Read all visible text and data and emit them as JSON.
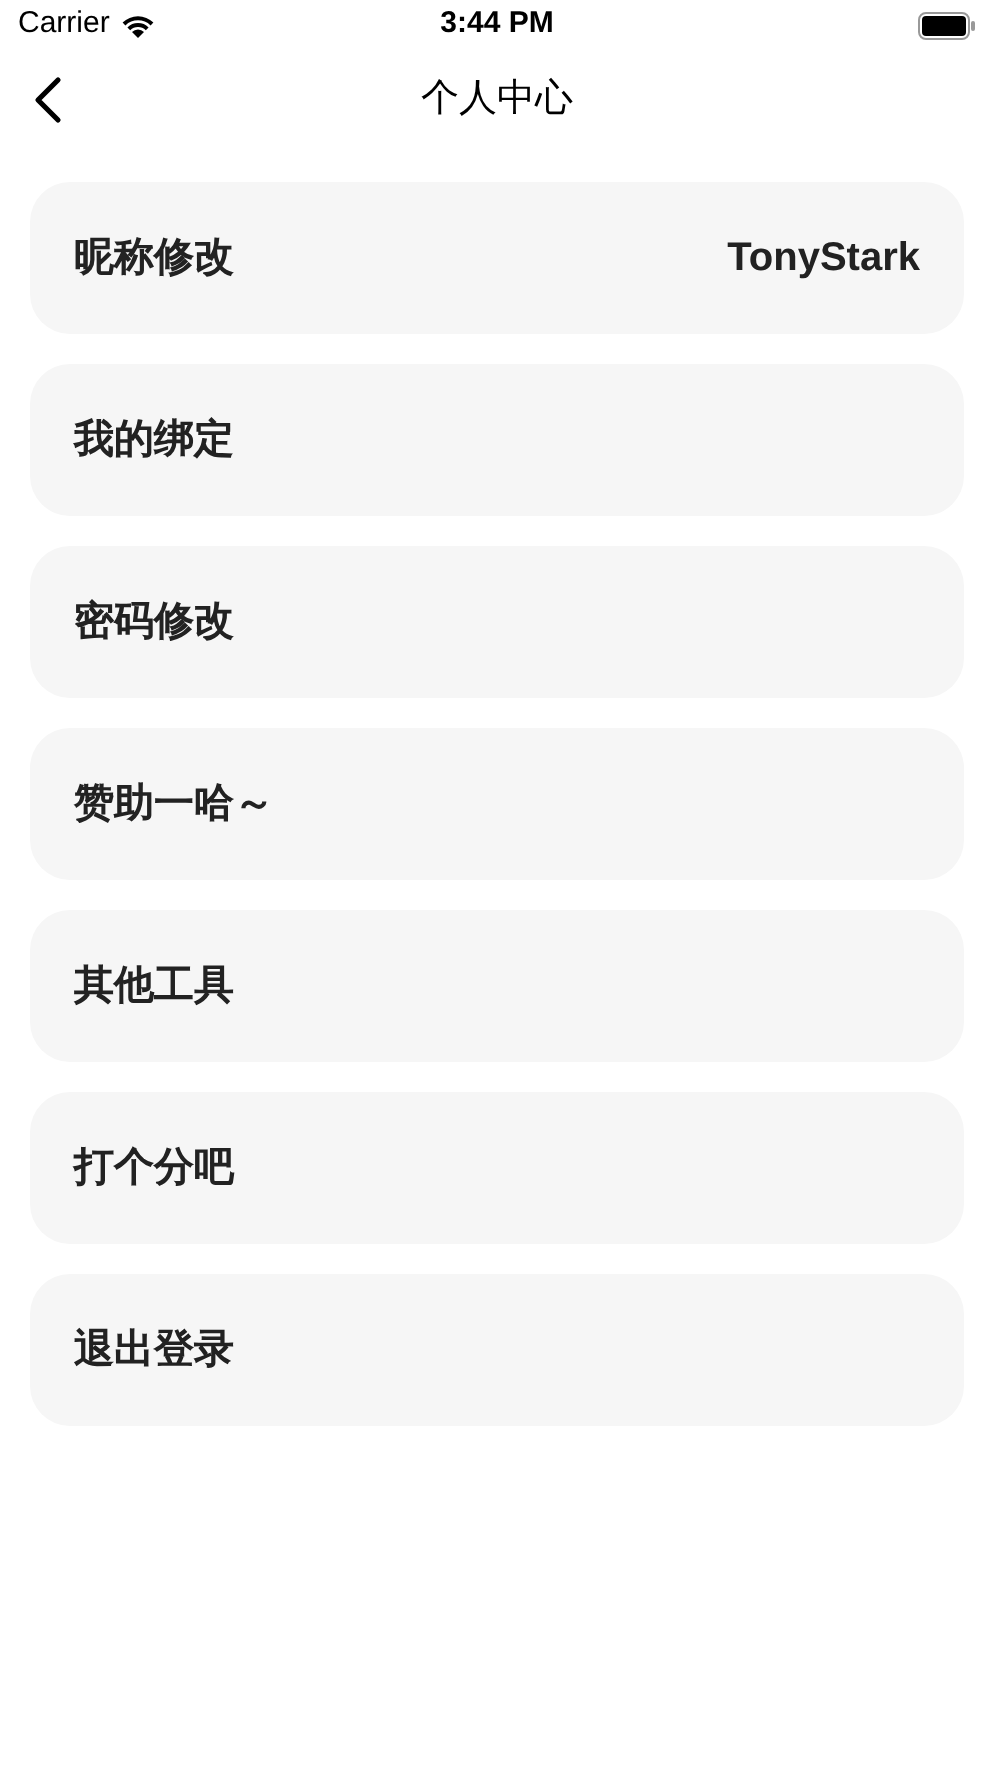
{
  "status_bar": {
    "carrier": "Carrier",
    "time": "3:44 PM"
  },
  "nav": {
    "title": "个人中心"
  },
  "items": [
    {
      "label": "昵称修改",
      "value": "TonyStark"
    },
    {
      "label": "我的绑定"
    },
    {
      "label": "密码修改"
    },
    {
      "label": "赞助一哈～"
    },
    {
      "label": "其他工具"
    },
    {
      "label": "打个分吧"
    },
    {
      "label": "退出登录"
    }
  ]
}
